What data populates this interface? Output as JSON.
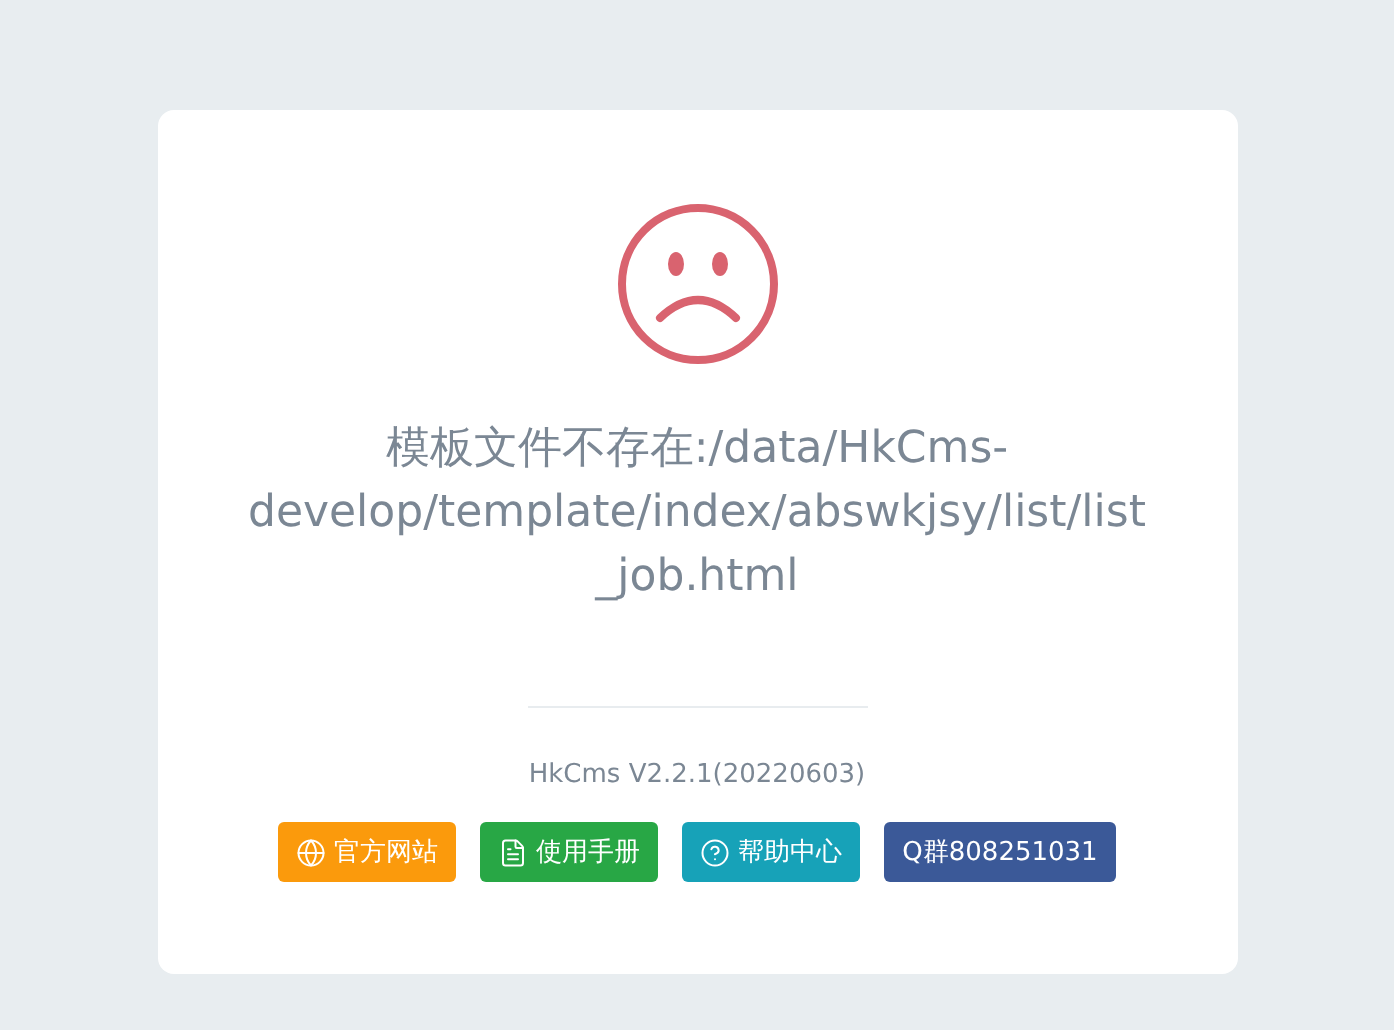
{
  "message_lines": [
    "模板文件不存在:/data/HkCms-",
    "develop/template/index/abswkjsy/list/list",
    "_job.html"
  ],
  "version": "HkCms V2.2.1(20220603)",
  "buttons": [
    {
      "label": "官方网站",
      "kind": "website",
      "color": "#fb9a0c"
    },
    {
      "label": "使用手册",
      "kind": "manual",
      "color": "#28a745"
    },
    {
      "label": "帮助中心",
      "kind": "help",
      "color": "#17a2b8"
    },
    {
      "label": "Q群808251031",
      "kind": "group",
      "color": "#3b5998"
    }
  ]
}
